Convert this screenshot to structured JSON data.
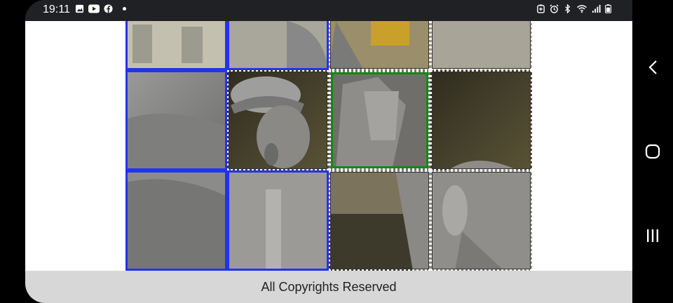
{
  "status_bar": {
    "time": "19:11",
    "left_icons": [
      "gallery-icon",
      "youtube-icon",
      "facebook-icon",
      "dot-icon"
    ],
    "right_icons": [
      "battery-saver-icon",
      "alarm-icon",
      "bluetooth-icon",
      "wifi-icon",
      "signal-icon",
      "battery-icon"
    ]
  },
  "footer": {
    "text": "All Copyrights Reserved"
  },
  "puzzle": {
    "rows": 3,
    "cols": 4,
    "frame_color": "#2233ee",
    "selected_tile_color": "#108a10",
    "tiles": [
      {
        "row": 0,
        "col": 0,
        "style": "blue"
      },
      {
        "row": 0,
        "col": 1,
        "style": "blue"
      },
      {
        "row": 0,
        "col": 2,
        "style": "dotted"
      },
      {
        "row": 0,
        "col": 3,
        "style": "dotted"
      },
      {
        "row": 1,
        "col": 0,
        "style": "blue"
      },
      {
        "row": 1,
        "col": 1,
        "style": "dotted"
      },
      {
        "row": 1,
        "col": 2,
        "style": "green"
      },
      {
        "row": 1,
        "col": 3,
        "style": "dotted"
      },
      {
        "row": 2,
        "col": 0,
        "style": "blue"
      },
      {
        "row": 2,
        "col": 1,
        "style": "blue"
      },
      {
        "row": 2,
        "col": 2,
        "style": "dotted"
      },
      {
        "row": 2,
        "col": 3,
        "style": "dotted"
      }
    ]
  },
  "nav_bar": {
    "buttons": [
      "back-icon",
      "home-icon",
      "recents-icon"
    ]
  }
}
